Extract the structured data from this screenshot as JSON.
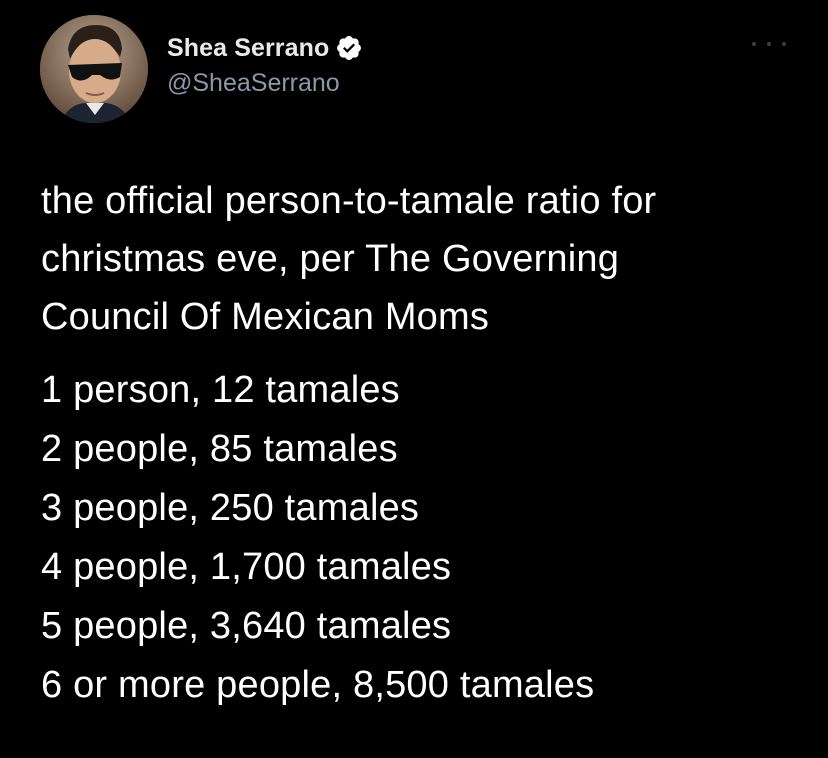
{
  "tweet": {
    "author": {
      "display_name": "Shea Serrano",
      "handle": "@SheaSerrano",
      "verified": true,
      "verified_color": "#ffffff"
    },
    "more_icon": "more-horizontal-icon",
    "text_lines": [
      "the official person-to-tamale ratio for",
      "christmas eve, per The Governing",
      "Council Of Mexican Moms"
    ],
    "list": [
      "1 person, 12 tamales",
      "2 people, 85 tamales",
      "3 people, 250 tamales",
      "4 people, 1,700 tamales",
      "5 people, 3,640 tamales",
      "6 or more people, 8,500 tamales"
    ]
  },
  "colors": {
    "background": "#000000",
    "primary_text": "#ffffff",
    "secondary_text": "#8b98a5"
  }
}
